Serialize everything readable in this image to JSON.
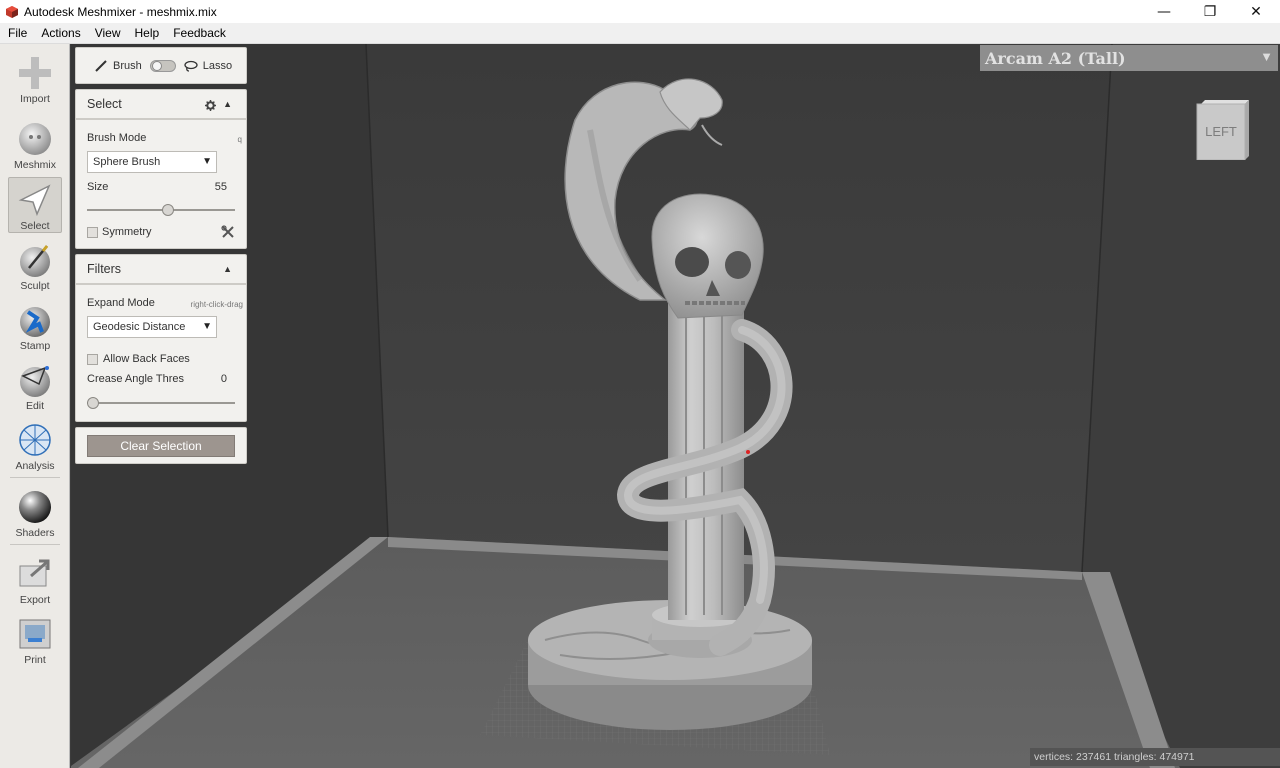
{
  "window": {
    "title": "Autodesk Meshmixer - meshmix.mix",
    "minimize_glyph": "—",
    "maximize_glyph": "❐",
    "close_glyph": "✕"
  },
  "menu": [
    "File",
    "Actions",
    "View",
    "Help",
    "Feedback"
  ],
  "toolbar": {
    "tools": [
      {
        "label": "Import",
        "icon": "plus-icon"
      },
      {
        "label": "Meshmix",
        "icon": "meshmix-sphere-icon"
      },
      {
        "label": "Select",
        "icon": "arrow-cursor-icon",
        "active": true
      },
      {
        "label": "Sculpt",
        "icon": "brush-sphere-icon"
      },
      {
        "label": "Stamp",
        "icon": "stamp-icon"
      },
      {
        "label": "Edit",
        "icon": "edit-sphere-icon"
      },
      {
        "label": "Analysis",
        "icon": "analysis-mesh-icon"
      },
      {
        "label": "Shaders",
        "icon": "shader-sphere-icon"
      },
      {
        "label": "Export",
        "icon": "export-icon"
      },
      {
        "label": "Print",
        "icon": "printer-icon"
      }
    ]
  },
  "mode_toggle": {
    "left": "Brush",
    "right": "Lasso"
  },
  "select_panel": {
    "title": "Select",
    "brush_mode_label": "Brush Mode",
    "brush_mode_hint": "q",
    "brush_mode_value": "Sphere Brush",
    "size_label": "Size",
    "size_value": "55",
    "size_fraction": 0.55,
    "symmetry_label": "Symmetry",
    "symmetry_checked": false
  },
  "filters_panel": {
    "title": "Filters",
    "expand_mode_label": "Expand Mode",
    "expand_mode_hint": "right-click-drag",
    "expand_mode_value": "Geodesic Distance",
    "allow_back_faces_label": "Allow Back Faces",
    "allow_back_faces_checked": false,
    "crease_label": "Crease Angle Thres",
    "crease_value": "0"
  },
  "clear_selection_label": "Clear Selection",
  "viewport": {
    "printer": "Arcam A2 (Tall)",
    "view_cube_label": "LEFT",
    "status": "vertices: 237461 triangles: 474971"
  }
}
